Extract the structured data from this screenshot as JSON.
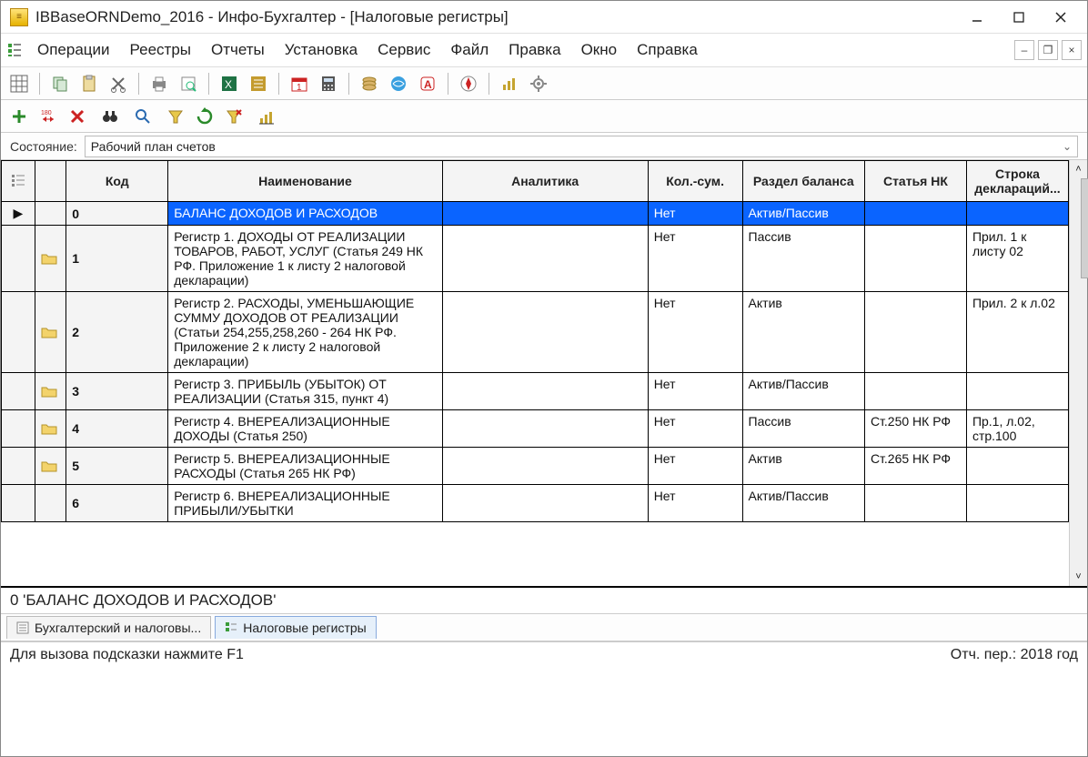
{
  "title": "IBBaseORNDemo_2016 - Инфо-Бухгалтер - [Налоговые регистры]",
  "menu": {
    "items": [
      "Операции",
      "Реестры",
      "Отчеты",
      "Установка",
      "Сервис",
      "Файл",
      "Правка",
      "Окно",
      "Справка"
    ]
  },
  "state": {
    "label": "Состояние:",
    "value": "Рабочий план счетов"
  },
  "columns": [
    "",
    "",
    "Код",
    "Наименование",
    "Аналитика",
    "Кол.-сум.",
    "Раздел баланса",
    "Статья НК",
    "Строка деклараций..."
  ],
  "listheader_icon_col": "",
  "rows": [
    {
      "pointer": "▶",
      "folder": false,
      "code": "0",
      "name": "БАЛАНС ДОХОДОВ И РАСХОДОВ",
      "analytics": "",
      "kol": "Нет",
      "balance": "Актив/Пассив",
      "art": "",
      "decl": "",
      "selected": true
    },
    {
      "pointer": "",
      "folder": true,
      "code": "1",
      "name": "Регистр 1. ДОХОДЫ ОТ РЕАЛИЗАЦИИ ТОВАРОВ, РАБОТ, УСЛУГ (Статья 249 НК РФ. Приложение 1 к листу 2 налоговой декларации)",
      "analytics": "",
      "kol": "Нет",
      "balance": "Пассив",
      "art": "",
      "decl": "Прил. 1 к листу 02",
      "selected": false
    },
    {
      "pointer": "",
      "folder": true,
      "code": "2",
      "name": "Регистр 2. РАСХОДЫ, УМЕНЬШАЮЩИЕ СУММУ ДОХОДОВ ОТ РЕАЛИЗАЦИИ (Статьи 254,255,258,260 - 264 НК РФ. Приложение 2 к листу 2 налоговой декларации)",
      "analytics": "",
      "kol": "Нет",
      "balance": "Актив",
      "art": "",
      "decl": "Прил. 2 к л.02",
      "selected": false
    },
    {
      "pointer": "",
      "folder": true,
      "code": "3",
      "name": "Регистр 3. ПРИБЫЛЬ (УБЫТОК) ОТ РЕАЛИЗАЦИИ (Статья 315, пункт 4)",
      "analytics": "",
      "kol": "Нет",
      "balance": "Актив/Пассив",
      "art": "",
      "decl": "",
      "selected": false
    },
    {
      "pointer": "",
      "folder": true,
      "code": "4",
      "name": "Регистр 4. ВНЕРЕАЛИЗАЦИОННЫЕ ДОХОДЫ (Статья 250)",
      "analytics": "",
      "kol": "Нет",
      "balance": "Пассив",
      "art": "Ст.250 НК РФ",
      "decl": "Пр.1, л.02, стр.100",
      "selected": false
    },
    {
      "pointer": "",
      "folder": true,
      "code": "5",
      "name": "Регистр 5. ВНЕРЕАЛИЗАЦИОННЫЕ РАСХОДЫ (Статья 265 НК РФ)",
      "analytics": "",
      "kol": "Нет",
      "balance": "Актив",
      "art": "Ст.265 НК РФ",
      "decl": "",
      "selected": false
    },
    {
      "pointer": "",
      "folder": false,
      "code": "6",
      "name": "Регистр 6. ВНЕРЕАЛИЗАЦИОННЫЕ ПРИБЫЛИ/УБЫТКИ",
      "analytics": "",
      "kol": "Нет",
      "balance": "Актив/Пассив",
      "art": "",
      "decl": "",
      "selected": false
    }
  ],
  "selection_string": "0 'БАЛАНС ДОХОДОВ И РАСХОДОВ'",
  "tabs": [
    {
      "label": "Бухгалтерский и налоговы...",
      "active": false
    },
    {
      "label": "Налоговые регистры",
      "active": true
    }
  ],
  "status": {
    "hint": "Для вызова подсказки нажмите F1",
    "period": "Отч. пер.: 2018 год"
  }
}
